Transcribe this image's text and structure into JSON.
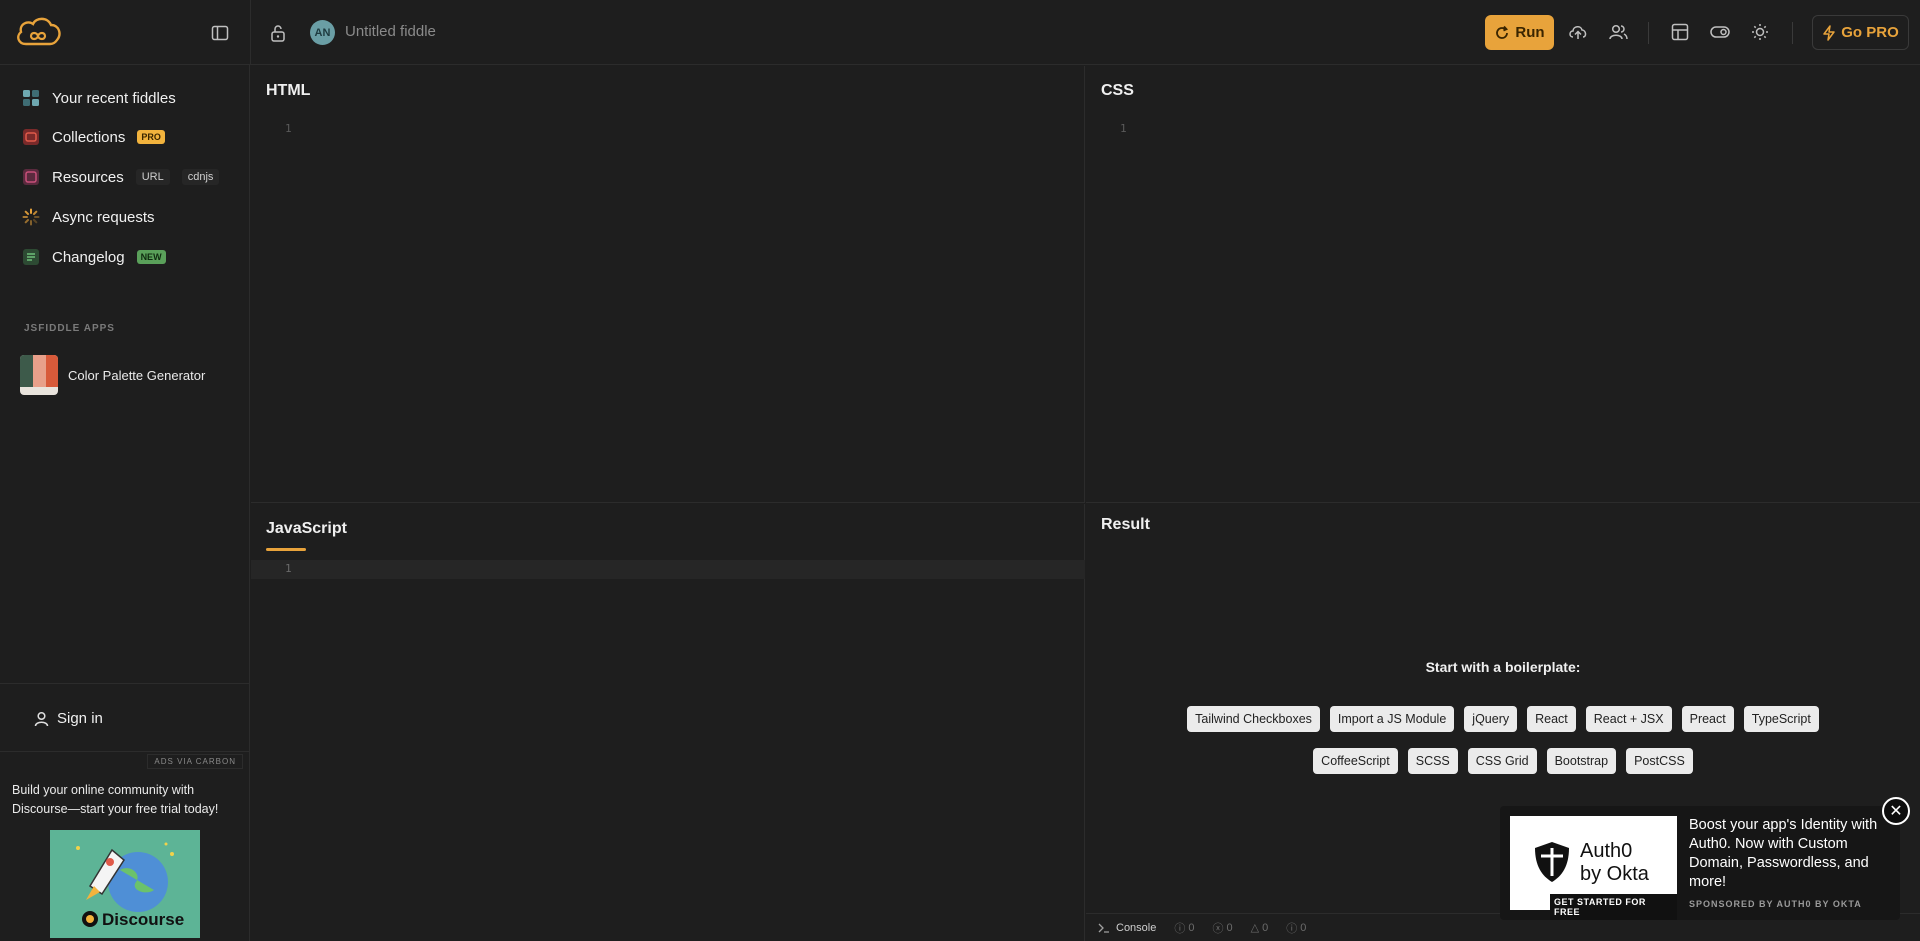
{
  "header": {
    "fiddle_title": "Untitled fiddle",
    "avatar_initials": "AN",
    "run_label": "Run",
    "gopro_label": "Go PRO",
    "accent": "#e8a33b"
  },
  "sidebar": {
    "items": [
      {
        "label": "Your recent fiddles",
        "icon": "grid-icon"
      },
      {
        "label": "Collections",
        "icon": "collection-icon",
        "badge": "PRO"
      },
      {
        "label": "Resources",
        "icon": "resources-icon",
        "tags": [
          "URL",
          "cdnjs"
        ]
      },
      {
        "label": "Async requests",
        "icon": "spinner-icon"
      },
      {
        "label": "Changelog",
        "icon": "changelog-icon",
        "badge": "NEW"
      }
    ],
    "apps_heading": "JSFIDDLE APPS",
    "apps": [
      {
        "label": "Color Palette Generator"
      }
    ],
    "sign_in": "Sign in",
    "ads_label": "ADS VIA CARBON",
    "ad_text": "Build your online community with Discourse—start your free trial today!",
    "ad_brand": "Discourse"
  },
  "editors": {
    "html": {
      "title": "HTML",
      "line": "1"
    },
    "css": {
      "title": "CSS",
      "line": "1"
    },
    "js": {
      "title": "JavaScript",
      "line": "1"
    },
    "result": {
      "title": "Result"
    }
  },
  "result": {
    "boilerplate_title": "Start with a boilerplate:",
    "row1": [
      "Tailwind Checkboxes",
      "Import a JS Module",
      "jQuery",
      "React",
      "React + JSX",
      "Preact",
      "TypeScript"
    ],
    "row2": [
      "CoffeeScript",
      "SCSS",
      "CSS Grid",
      "Bootstrap",
      "PostCSS"
    ]
  },
  "console": {
    "label": "Console",
    "counts": [
      "0",
      "0",
      "0",
      "0"
    ]
  },
  "auth_ad": {
    "text": "Boost your app's Identity with Auth0. Now with Custom Domain, Passwordless, and more!",
    "sponsor": "SPONSORED BY AUTH0 BY OKTA",
    "logo_line1": "Auth0",
    "logo_line2": "by Okta",
    "cta": "GET STARTED FOR FREE"
  }
}
